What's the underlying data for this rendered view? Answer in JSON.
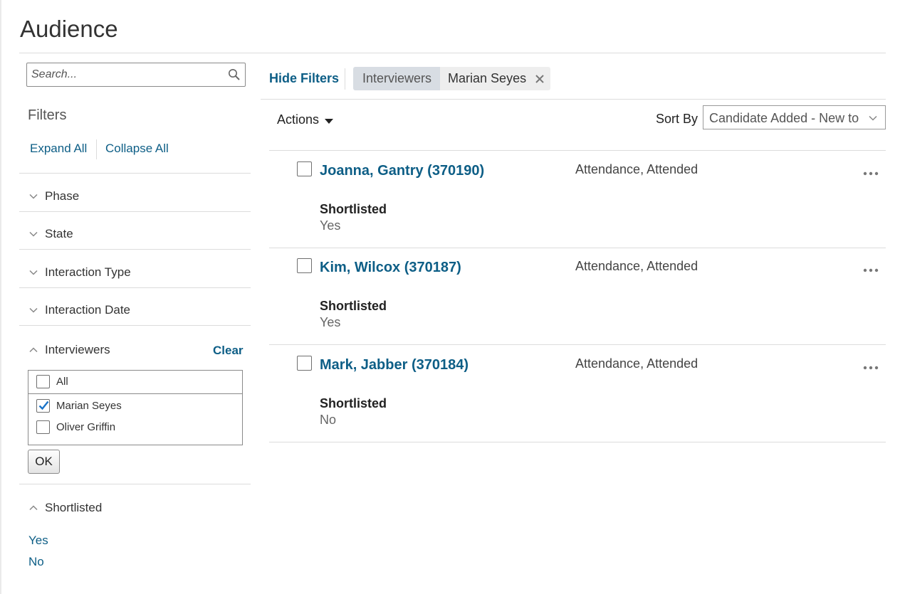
{
  "page": {
    "title": "Audience"
  },
  "search": {
    "placeholder": "Search..."
  },
  "filters": {
    "heading": "Filters",
    "expand_all": "Expand All",
    "collapse_all": "Collapse All",
    "facets": {
      "phase": "Phase",
      "state": "State",
      "interaction_type": "Interaction Type",
      "interaction_date": "Interaction Date",
      "interviewers": "Interviewers",
      "shortlisted": "Shortlisted"
    },
    "interviewers": {
      "clear": "Clear",
      "options": [
        {
          "label": "All",
          "checked": false
        },
        {
          "label": "Marian Seyes",
          "checked": true
        },
        {
          "label": "Oliver Griffin",
          "checked": false
        }
      ],
      "ok": "OK"
    },
    "shortlisted_options": [
      "Yes",
      "No"
    ]
  },
  "toolbar": {
    "hide_filters": "Hide Filters",
    "active_filter": {
      "category": "Interviewers",
      "value": "Marian Seyes"
    },
    "actions": "Actions",
    "sort_by_label": "Sort By",
    "sort_value": "Candidate Added - New to Old"
  },
  "candidates": [
    {
      "name": "Joanna, Gantry (370190)",
      "status": "Attendance, Attended",
      "shortlisted_label": "Shortlisted",
      "shortlisted": "Yes"
    },
    {
      "name": "Kim, Wilcox (370187)",
      "status": "Attendance, Attended",
      "shortlisted_label": "Shortlisted",
      "shortlisted": "Yes"
    },
    {
      "name": "Mark, Jabber (370184)",
      "status": "Attendance, Attended",
      "shortlisted_label": "Shortlisted",
      "shortlisted": "No"
    }
  ],
  "colors": {
    "link": "#0d5e86",
    "chip_category_bg": "#d8dde3",
    "chip_value_bg": "#eeeeee",
    "check": "#1a73c8"
  }
}
